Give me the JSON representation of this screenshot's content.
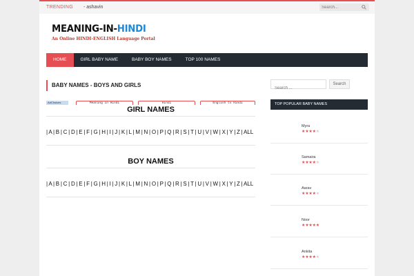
{
  "topbar": {
    "trending_label": "TRENDING",
    "trending_item": "- ashavin",
    "search_placeholder": "Search..."
  },
  "logo": {
    "part1": "MEANING-IN-",
    "part2": "HINDI",
    "tagline": "An Online HINDI-ENGLISH Language Portal"
  },
  "nav": {
    "items": [
      {
        "label": "HOME",
        "active": true
      },
      {
        "label": "GIRL BABY NAME"
      },
      {
        "label": "BABY BOY NAMES"
      },
      {
        "label": "TOP 100 NAMES"
      }
    ]
  },
  "main": {
    "heading": "BABY NAMES - BOYS AND GIRLS",
    "ad": {
      "adchoices": "AdChoices",
      "buttons": [
        "Meaning in Hindi",
        "Hindi",
        "English to Hindi"
      ]
    },
    "girl_title": "GIRL NAMES",
    "boy_title": "BOY NAMES",
    "girl_letters": "| A | B | C | D | E | F | G | H | I | J | K | L | M | N | O | P | Q | R | S | T | U | V | W | X | Y | Z | ALL",
    "boy_letters": "| A | B | C | D | E | F | G | H | I | J | K | L | M | N | O | P | Q | R | S | T | U | V | W | X | Y | Z | ALL"
  },
  "sidebar": {
    "search_placeholder": "Search ...",
    "search_button": "Search",
    "popular_title": "TOP POPULAR BABY NAMES",
    "popular": [
      {
        "name": "Myra",
        "rating": 4
      },
      {
        "name": "Samaira",
        "rating": 4
      },
      {
        "name": "Aarav",
        "rating": 4
      },
      {
        "name": "Noor",
        "rating": 5
      },
      {
        "name": "Ankita",
        "rating": 4
      }
    ]
  },
  "colors": {
    "accent": "#e54e53",
    "nav_bg": "#252b33",
    "logo_blue": "#1e88d4"
  }
}
